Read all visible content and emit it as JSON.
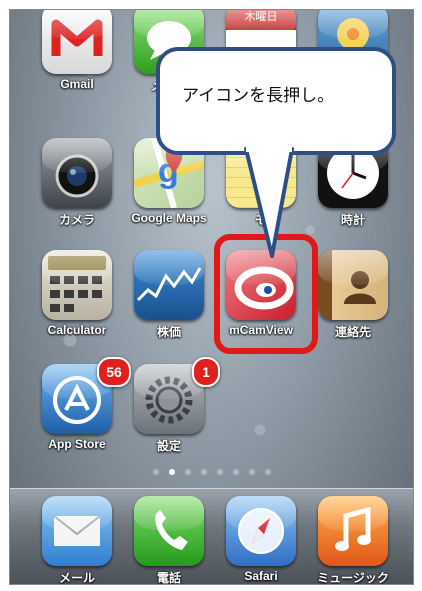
{
  "callout": {
    "text": "アイコンを長押し。"
  },
  "calendar_partial": {
    "day_label": "木曜日"
  },
  "rows": [
    [
      {
        "name": "gmail",
        "label": "Gmail",
        "icon": "gmail-icon"
      },
      {
        "name": "messages",
        "label": "メッセ",
        "icon": "messages-icon"
      },
      {
        "name": "calendar",
        "label": "",
        "icon": "calendar-icon"
      },
      {
        "name": "photos",
        "label": "",
        "icon": "photos-icon"
      }
    ],
    [
      {
        "name": "camera",
        "label": "カメラ",
        "icon": "camera-icon"
      },
      {
        "name": "google-maps",
        "label": "Google Maps",
        "icon": "google-maps-icon"
      },
      {
        "name": "notes",
        "label": "モ",
        "icon": "notes-icon"
      },
      {
        "name": "clock",
        "label": "時計",
        "icon": "clock-icon"
      }
    ],
    [
      {
        "name": "calculator",
        "label": "Calculator",
        "icon": "calculator-icon"
      },
      {
        "name": "stocks",
        "label": "株価",
        "icon": "stocks-icon"
      },
      {
        "name": "mcamview",
        "label": "mCamView",
        "icon": "mcamview-icon"
      },
      {
        "name": "contacts",
        "label": "連絡先",
        "icon": "contacts-icon"
      }
    ],
    [
      {
        "name": "app-store",
        "label": "App Store",
        "icon": "app-store-icon",
        "badge": "56"
      },
      {
        "name": "settings",
        "label": "設定",
        "icon": "settings-icon",
        "badge": "1"
      }
    ]
  ],
  "dock": [
    {
      "name": "mail",
      "label": "メール",
      "icon": "mail-icon"
    },
    {
      "name": "phone",
      "label": "電話",
      "icon": "phone-icon"
    },
    {
      "name": "safari",
      "label": "Safari",
      "icon": "safari-icon"
    },
    {
      "name": "music",
      "label": "ミュージック",
      "icon": "music-icon"
    }
  ],
  "page_dots": {
    "count": 8,
    "active": 1
  }
}
